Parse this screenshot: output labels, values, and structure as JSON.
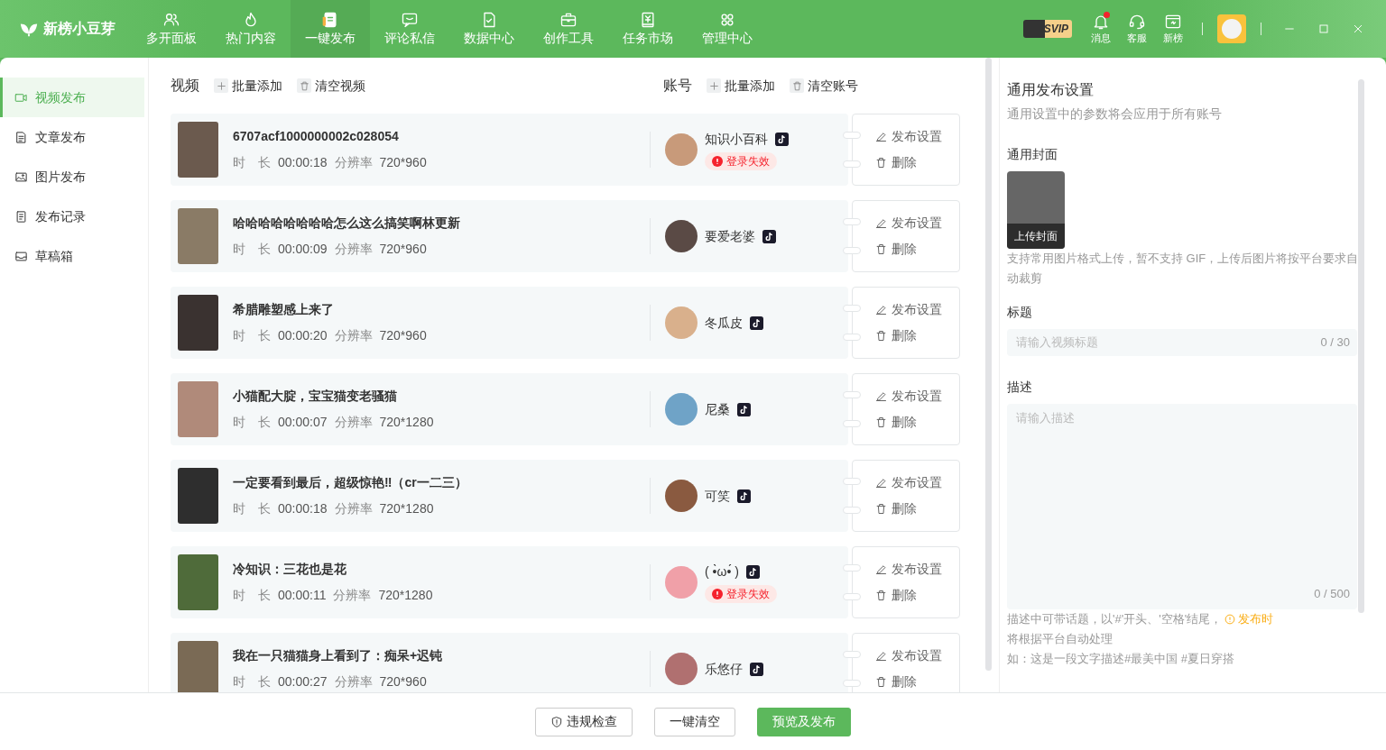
{
  "app": {
    "name": "新榜小豆芽"
  },
  "nav": [
    {
      "label": "多开面板",
      "kind": "users",
      "selected": false
    },
    {
      "label": "热门内容",
      "kind": "flame",
      "selected": false
    },
    {
      "label": "一键发布",
      "kind": "doc",
      "selected": true
    },
    {
      "label": "评论私信",
      "kind": "chat",
      "selected": false
    },
    {
      "label": "数据中心",
      "kind": "filecheck",
      "selected": false
    },
    {
      "label": "创作工具",
      "kind": "briefcase",
      "selected": false
    },
    {
      "label": "任务市场",
      "kind": "book",
      "selected": false
    },
    {
      "label": "管理中心",
      "kind": "grid",
      "selected": false
    }
  ],
  "top_right": {
    "vip": "SVIP",
    "items": [
      {
        "label": "消息",
        "kind": "bell",
        "badge": true
      },
      {
        "label": "客服",
        "kind": "headset",
        "badge": false
      },
      {
        "label": "新榜",
        "kind": "window",
        "badge": false
      }
    ]
  },
  "sidebar": [
    {
      "label": "视频发布",
      "kind": "video",
      "selected": true
    },
    {
      "label": "文章发布",
      "kind": "article",
      "selected": false
    },
    {
      "label": "图片发布",
      "kind": "image",
      "selected": false
    },
    {
      "label": "发布记录",
      "kind": "record",
      "selected": false
    },
    {
      "label": "草稿箱",
      "kind": "inbox",
      "selected": false
    }
  ],
  "video_header": {
    "title": "视频",
    "actions": [
      {
        "label": "批量添加",
        "kind": "plus"
      },
      {
        "label": "清空视频",
        "kind": "trash"
      }
    ]
  },
  "account_header": {
    "title": "账号",
    "actions": [
      {
        "label": "批量添加",
        "kind": "plus"
      },
      {
        "label": "清空账号",
        "kind": "trash"
      }
    ]
  },
  "rows": [
    {
      "title": "6707acf1000000002c028054",
      "duration_label": "时　长",
      "duration": "00:00:18",
      "resolution_label": "分辨率",
      "resolution": "720*960",
      "account": "知识小百科",
      "login_failed": true,
      "status": "登录失效",
      "actions": [
        "发布设置",
        "删除"
      ]
    },
    {
      "title": "哈哈哈哈哈哈哈哈怎么这么搞笑啊林更新",
      "duration_label": "时　长",
      "duration": "00:00:09",
      "resolution_label": "分辨率",
      "resolution": "720*960",
      "account": "要爱老婆",
      "login_failed": false,
      "actions": [
        "发布设置",
        "删除"
      ]
    },
    {
      "title": "希腊雕塑感上来了",
      "duration_label": "时　长",
      "duration": "00:00:20",
      "resolution_label": "分辨率",
      "resolution": "720*960",
      "account": "冬瓜皮",
      "login_failed": false,
      "actions": [
        "发布设置",
        "删除"
      ]
    },
    {
      "title": "小猫配大腚，宝宝猫变老骚猫",
      "duration_label": "时　长",
      "duration": "00:00:07",
      "resolution_label": "分辨率",
      "resolution": "720*1280",
      "account": "尼桑",
      "login_failed": false,
      "actions": [
        "发布设置",
        "删除"
      ]
    },
    {
      "title": "一定要看到最后，超级惊艳‼（cr一二三）",
      "duration_label": "时　长",
      "duration": "00:00:18",
      "resolution_label": "分辨率",
      "resolution": "720*1280",
      "account": "可笑",
      "login_failed": false,
      "actions": [
        "发布设置",
        "删除"
      ]
    },
    {
      "title": "冷知识：三花也是花",
      "duration_label": "时　长",
      "duration": "00:00:11",
      "resolution_label": "分辨率",
      "resolution": "720*1280",
      "account": "( •̀ω•́ )",
      "login_failed": true,
      "status": "登录失效",
      "actions": [
        "发布设置",
        "删除"
      ]
    },
    {
      "title": "我在一只猫猫身上看到了：痴呆+迟钝",
      "duration_label": "时　长",
      "duration": "00:00:27",
      "resolution_label": "分辨率",
      "resolution": "720*960",
      "account": "乐悠仔",
      "login_failed": false,
      "actions": [
        "发布设置",
        "删除"
      ]
    }
  ],
  "settings": {
    "title": "通用发布设置",
    "subtitle": "通用设置中的参数将会应用于所有账号",
    "cover_label": "通用封面",
    "cover_button": "上传封面",
    "cover_hint": "支持常用图片格式上传，暂不支持 GIF，上传后图片将按平台要求自动裁剪",
    "title_label": "标题",
    "title_placeholder": "请输入视频标题",
    "title_count": "0 / 30",
    "desc_label": "描述",
    "desc_placeholder": "请输入描述",
    "desc_count": "0 / 500",
    "desc_hint_before": "描述中可带话题，以'#'开头、'空格'结尾，",
    "desc_hint_highlight": "发布时",
    "desc_hint_after": "将根据平台自动处理",
    "desc_example": "如：这是一段文字描述#最美中国 #夏日穿搭"
  },
  "footer": [
    {
      "label": "违规检查",
      "kind": "icon"
    },
    {
      "label": "一键清空",
      "kind": "plain"
    },
    {
      "label": "预览及发布",
      "kind": "primary"
    }
  ]
}
